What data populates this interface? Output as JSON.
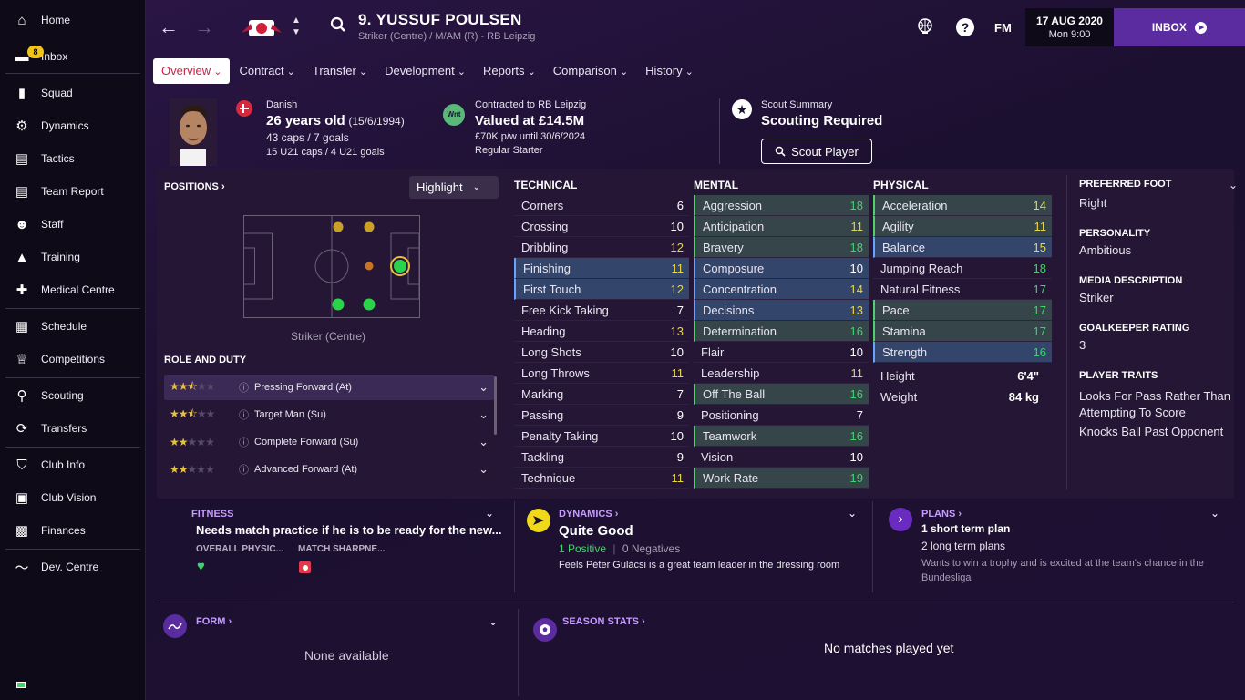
{
  "sidebar": {
    "items": [
      {
        "label": "Home",
        "icon": "home-icon"
      },
      {
        "label": "Inbox",
        "icon": "inbox-icon",
        "badge": "8"
      },
      {
        "label": "Squad",
        "icon": "shirt-icon"
      },
      {
        "label": "Dynamics",
        "icon": "dynamics-icon"
      },
      {
        "label": "Tactics",
        "icon": "tactics-icon"
      },
      {
        "label": "Team Report",
        "icon": "report-icon"
      },
      {
        "label": "Staff",
        "icon": "staff-icon"
      },
      {
        "label": "Training",
        "icon": "training-icon"
      },
      {
        "label": "Medical Centre",
        "icon": "medical-icon"
      },
      {
        "label": "Schedule",
        "icon": "calendar-icon"
      },
      {
        "label": "Competitions",
        "icon": "trophy-icon"
      },
      {
        "label": "Scouting",
        "icon": "search-icon"
      },
      {
        "label": "Transfers",
        "icon": "transfer-icon"
      },
      {
        "label": "Club Info",
        "icon": "shield-icon"
      },
      {
        "label": "Club Vision",
        "icon": "briefcase-icon"
      },
      {
        "label": "Finances",
        "icon": "finance-icon"
      },
      {
        "label": "Dev. Centre",
        "icon": "devcentre-icon"
      }
    ]
  },
  "header": {
    "title": "9. YUSSUF POULSEN",
    "subtitle": "Striker (Centre) / M/AM (R) - RB Leipzig",
    "fm_label": "FM",
    "date": "17 AUG 2020",
    "time": "Mon 9:00",
    "inbox_label": "INBOX"
  },
  "tabs": [
    "Overview",
    "Contract",
    "Transfer",
    "Development",
    "Reports",
    "Comparison",
    "History"
  ],
  "profile": {
    "nationality": "Danish",
    "age": "26 years old",
    "dob": "(15/6/1994)",
    "caps": "43 caps / 7 goals",
    "u21": "15 U21 caps / 4 U21 goals",
    "contract_label": "Contracted to RB Leipzig",
    "value": "Valued at £14.5M",
    "wage": "£70K p/w until 30/6/2024",
    "status": "Regular Starter",
    "wnt_badge": "Wnt",
    "scout_label": "Scout Summary",
    "scout_status": "Scouting Required",
    "scout_button": "Scout Player"
  },
  "positions": {
    "title": "POSITIONS",
    "highlight": "Highlight",
    "position_name": "Striker (Centre)",
    "role_title": "ROLE AND DUTY",
    "roles": [
      {
        "name": "Pressing Forward (At)",
        "stars": 2.5
      },
      {
        "name": "Target Man (Su)",
        "stars": 2.5
      },
      {
        "name": "Complete Forward (Su)",
        "stars": 2
      },
      {
        "name": "Advanced Forward (At)",
        "stars": 2
      }
    ]
  },
  "technical": {
    "title": "TECHNICAL",
    "attrs": [
      [
        "Corners",
        "6"
      ],
      [
        "Crossing",
        "10"
      ],
      [
        "Dribbling",
        "12"
      ],
      [
        "Finishing",
        "11"
      ],
      [
        "First Touch",
        "12"
      ],
      [
        "Free Kick Taking",
        "7"
      ],
      [
        "Heading",
        "13"
      ],
      [
        "Long Shots",
        "10"
      ],
      [
        "Long Throws",
        "11"
      ],
      [
        "Marking",
        "7"
      ],
      [
        "Passing",
        "9"
      ],
      [
        "Penalty Taking",
        "10"
      ],
      [
        "Tackling",
        "9"
      ],
      [
        "Technique",
        "11"
      ]
    ]
  },
  "mental": {
    "title": "MENTAL",
    "attrs": [
      [
        "Aggression",
        "18"
      ],
      [
        "Anticipation",
        "11"
      ],
      [
        "Bravery",
        "18"
      ],
      [
        "Composure",
        "10"
      ],
      [
        "Concentration",
        "14"
      ],
      [
        "Decisions",
        "13"
      ],
      [
        "Determination",
        "16"
      ],
      [
        "Flair",
        "10"
      ],
      [
        "Leadership",
        "11"
      ],
      [
        "Off The Ball",
        "16"
      ],
      [
        "Positioning",
        "7"
      ],
      [
        "Teamwork",
        "16"
      ],
      [
        "Vision",
        "10"
      ],
      [
        "Work Rate",
        "19"
      ]
    ]
  },
  "physical": {
    "title": "PHYSICAL",
    "attrs": [
      [
        "Acceleration",
        "14"
      ],
      [
        "Agility",
        "11"
      ],
      [
        "Balance",
        "15"
      ],
      [
        "Jumping Reach",
        "18"
      ],
      [
        "Natural Fitness",
        "17"
      ],
      [
        "Pace",
        "17"
      ],
      [
        "Stamina",
        "17"
      ],
      [
        "Strength",
        "16"
      ]
    ],
    "height_label": "Height",
    "height": "6'4\"",
    "weight_label": "Weight",
    "weight": "84 kg"
  },
  "info": {
    "foot_h": "PREFERRED FOOT",
    "foot": "Right",
    "pers_h": "PERSONALITY",
    "pers": "Ambitious",
    "media_h": "MEDIA DESCRIPTION",
    "media": "Striker",
    "gk_h": "GOALKEEPER RATING",
    "gk": "3",
    "traits_h": "PLAYER TRAITS",
    "trait1": "Looks For Pass Rather Than Attempting To Score",
    "trait2": "Knocks Ball Past Opponent"
  },
  "fitness": {
    "title": "FITNESS",
    "text": "Needs match practice if he is to be ready for the new...",
    "overall": "OVERALL PHYSIC...",
    "sharpness": "MATCH SHARPNE..."
  },
  "dynamics": {
    "title": "DYNAMICS",
    "status": "Quite Good",
    "positive": "1 Positive",
    "negative": "0 Negatives",
    "desc": "Feels Péter Gulácsi is a great team leader in the dressing room"
  },
  "plans": {
    "title": "PLANS",
    "short": "1 short term plan",
    "long": "2 long term plans",
    "desc": "Wants to win a trophy and is excited at the team's chance in the Bundesliga"
  },
  "form": {
    "title": "FORM",
    "empty": "None available"
  },
  "season": {
    "title": "SEASON STATS",
    "empty": "No matches played yet"
  },
  "colors": {
    "accent": "#5a2ca0",
    "highlight_blue": "#33456a",
    "highlight_green": "#35454a",
    "value_yellow": "#e6d64a",
    "value_green": "#3fd46a"
  }
}
